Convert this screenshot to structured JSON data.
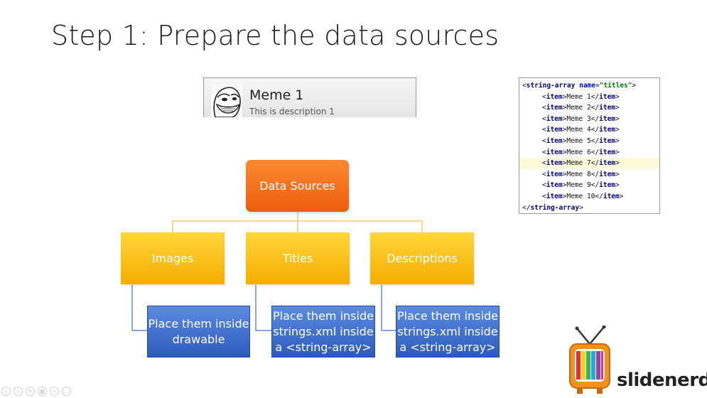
{
  "slide": {
    "title": "Step 1: Prepare the data sources"
  },
  "list_preview": {
    "title": "Meme 1",
    "description": "This is description 1",
    "icon": "troll-face-icon"
  },
  "code": {
    "open_tag": "string-array",
    "attr_name": "name",
    "attr_value": "\"titles\"",
    "item_tag": "item",
    "items": [
      "Meme 1",
      "Meme 2",
      "Meme 3",
      "Meme 4",
      "Meme 5",
      "Meme 6",
      "Meme 7",
      "Meme 8",
      "Meme 9",
      "Meme 10"
    ],
    "highlighted_index": 6
  },
  "diagram": {
    "root": "Data Sources",
    "children": [
      {
        "label": "Images",
        "detail": "Place them inside drawable"
      },
      {
        "label": "Titles",
        "detail": "Place them inside strings.xml inside a <string-array>"
      },
      {
        "label": "Descriptions",
        "detail": "Place them inside strings.xml inside a <string-array>"
      }
    ]
  },
  "logo": {
    "text": "slidenerd",
    "icon": "retro-tv-icon"
  },
  "colors": {
    "root": "#f47321",
    "category": "#fbbf0f",
    "detail": "#3f6fd0",
    "connector": "#f0c040"
  }
}
